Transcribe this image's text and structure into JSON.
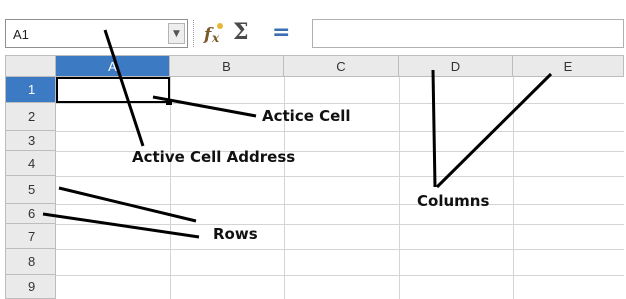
{
  "formula_bar": {
    "name_box_value": "A1",
    "icons": [
      "function-wizard-icon",
      "sum-icon",
      "formula-equals-icon"
    ],
    "formula_value": ""
  },
  "grid": {
    "column_headers": [
      "A",
      "B",
      "C",
      "D",
      "E"
    ],
    "row_headers": [
      "1",
      "2",
      "3",
      "4",
      "5",
      "6",
      "7",
      "8",
      "9"
    ],
    "active_cell": "A1"
  },
  "annotations": {
    "active_cell": "Actice Cell",
    "active_cell_address": "Active Cell Address",
    "rows": "Rows",
    "columns": "Columns"
  },
  "colors": {
    "header_bg": "#eaeaea",
    "active_header_bg": "#3c7bc4",
    "grid_line": "#d4d4d4"
  }
}
